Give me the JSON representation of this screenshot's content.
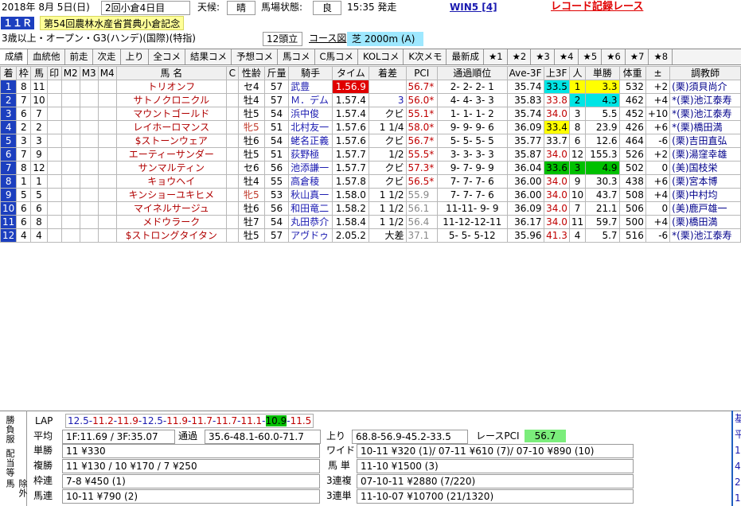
{
  "header": {
    "date": "2018年  8月  5日(日)",
    "meeting": "2回小倉4日目",
    "weather_label": "天候:",
    "weather": "晴",
    "going_label": "馬場状態:",
    "going": "良",
    "start_time": "15:35 発走",
    "win5": "WIN5 [4]",
    "record_race": "レコード記録レース"
  },
  "race": {
    "number": "１１Ｒ",
    "title": "第54回農林水産省賞典小倉記念",
    "conditions": "3歳以上・オープン・G3(ハンデ)(国際)(特指)",
    "runners": "12頭立",
    "course_label": "コース図",
    "course": "芝 2000m (A)"
  },
  "tabs": [
    "成績",
    "血統他",
    "前走",
    "次走",
    "上り",
    "全コメ",
    "結果コメ",
    "予想コメ",
    "馬コメ",
    "C馬コメ",
    "KOLコメ",
    "K次メモ",
    "最新成",
    "★1",
    "★2",
    "★3",
    "★4",
    "★5",
    "★6",
    "★7",
    "★8"
  ],
  "columns": [
    "着",
    "枠",
    "馬",
    "印",
    "M2",
    "M3",
    "M4",
    "馬 名",
    "C",
    "性齢",
    "斤量",
    "騎手",
    "タイム",
    "着差",
    "PCI",
    "通過順位",
    "Ave-3F",
    "上3F",
    "人",
    "単勝",
    "体重",
    "±",
    "調教師"
  ],
  "rows": [
    {
      "rank": "1",
      "waku": "8",
      "uma": "11",
      "name": "トリオンフ",
      "sex": "セ4",
      "kin": "57",
      "jockey": "武豊",
      "time": "1.56.9",
      "margin": "",
      "pci": "56.7*",
      "passing": "2- 2- 2- 1",
      "ave": "35.74",
      "last3f": "33.5",
      "pop": "1",
      "odds": "3.3",
      "weight": "532",
      "diff": "+2",
      "trainer": "(栗)須貝尚介"
    },
    {
      "rank": "2",
      "waku": "7",
      "uma": "10",
      "name": "サトノクロニクル",
      "sex": "牡4",
      "kin": "57",
      "jockey": "Ｍ．デム",
      "time": "1.57.4",
      "margin": "3",
      "pci": "56.0*",
      "passing": "4- 4- 3- 3",
      "ave": "35.83",
      "last3f": "33.8",
      "pop": "2",
      "odds": "4.3",
      "weight": "462",
      "diff": "+4",
      "trainer": "*(栗)池江泰寿"
    },
    {
      "rank": "3",
      "waku": "6",
      "uma": "7",
      "name": "マウントゴールド",
      "sex": "牡5",
      "kin": "54",
      "jockey": "浜中俊",
      "time": "1.57.4",
      "margin": "クビ",
      "pci": "55.1*",
      "passing": "1- 1- 1- 2",
      "ave": "35.74",
      "last3f": "34.0",
      "pop": "3",
      "odds": "5.5",
      "weight": "452",
      "diff": "+10",
      "trainer": "*(栗)池江泰寿"
    },
    {
      "rank": "4",
      "waku": "2",
      "uma": "2",
      "name": "レイホーロマンス",
      "sex": "牝5",
      "kin": "51",
      "jockey": "北村友一",
      "time": "1.57.6",
      "margin": "1 1/4",
      "pci": "58.0*",
      "passing": "9- 9- 9- 6",
      "ave": "36.09",
      "last3f": "33.4",
      "pop": "8",
      "odds": "23.9",
      "weight": "426",
      "diff": "+6",
      "trainer": "*(栗)橋田満"
    },
    {
      "rank": "5",
      "waku": "3",
      "uma": "3",
      "name": "$ストーンウェア",
      "sex": "牡6",
      "kin": "54",
      "jockey": "蛯名正義",
      "time": "1.57.6",
      "margin": "クビ",
      "pci": "56.7*",
      "passing": "5- 5- 5- 5",
      "ave": "35.77",
      "last3f": "33.7",
      "pop": "6",
      "odds": "12.6",
      "weight": "464",
      "diff": "-6",
      "trainer": "(栗)吉田直弘"
    },
    {
      "rank": "6",
      "waku": "7",
      "uma": "9",
      "name": "エーティーサンダー",
      "sex": "牡5",
      "kin": "51",
      "jockey": "荻野極",
      "time": "1.57.7",
      "margin": "1/2",
      "pci": "55.5*",
      "passing": "3- 3- 3- 3",
      "ave": "35.87",
      "last3f": "34.0",
      "pop": "12",
      "odds": "155.3",
      "weight": "526",
      "diff": "+2",
      "trainer": "(栗)湯窪幸雄"
    },
    {
      "rank": "7",
      "waku": "8",
      "uma": "12",
      "name": "サンマルティン",
      "sex": "セ6",
      "kin": "56",
      "jockey": "池添謙一",
      "time": "1.57.7",
      "margin": "クビ",
      "pci": "57.3*",
      "passing": "9- 7- 9- 9",
      "ave": "36.04",
      "last3f": "33.6",
      "pop": "3",
      "odds": "4.9",
      "weight": "502",
      "diff": "0",
      "trainer": "(美)国枝栄"
    },
    {
      "rank": "8",
      "waku": "1",
      "uma": "1",
      "name": "キョウヘイ",
      "sex": "牡4",
      "kin": "55",
      "jockey": "高倉稜",
      "time": "1.57.8",
      "margin": "クビ",
      "pci": "56.5*",
      "passing": "7- 7- 7- 6",
      "ave": "36.00",
      "last3f": "34.0",
      "pop": "9",
      "odds": "30.3",
      "weight": "438",
      "diff": "+6",
      "trainer": "(栗)宮本博"
    },
    {
      "rank": "9",
      "waku": "5",
      "uma": "5",
      "name": "キンショーユキヒメ",
      "sex": "牝5",
      "kin": "53",
      "jockey": "秋山真一",
      "time": "1.58.0",
      "margin": "1 1/2",
      "pci": "55.9",
      "passing": "7- 7- 7- 6",
      "ave": "36.00",
      "last3f": "34.0",
      "pop": "10",
      "odds": "43.7",
      "weight": "508",
      "diff": "+4",
      "trainer": "(栗)中村均"
    },
    {
      "rank": "10",
      "waku": "6",
      "uma": "6",
      "name": "マイネルサージュ",
      "sex": "牡6",
      "kin": "56",
      "jockey": "和田竜二",
      "time": "1.58.2",
      "margin": "1 1/2",
      "pci": "56.1",
      "passing": "11-11- 9- 9",
      "ave": "36.09",
      "last3f": "34.0",
      "pop": "7",
      "odds": "21.1",
      "weight": "506",
      "diff": "0",
      "trainer": "(美)鹿戸雄一"
    },
    {
      "rank": "11",
      "waku": "6",
      "uma": "8",
      "name": "メドウラーク",
      "sex": "牡7",
      "kin": "54",
      "jockey": "丸田恭介",
      "time": "1.58.4",
      "margin": "1 1/2",
      "pci": "56.4",
      "passing": "11-12-12-11",
      "ave": "36.17",
      "last3f": "34.0",
      "pop": "11",
      "odds": "59.7",
      "weight": "500",
      "diff": "+4",
      "trainer": "(栗)橋田満"
    },
    {
      "rank": "12",
      "waku": "4",
      "uma": "4",
      "name": "$ストロングタイタン",
      "sex": "牡5",
      "kin": "57",
      "jockey": "アヴドゥ",
      "time": "2.05.2",
      "margin": "大差",
      "pci": "37.1",
      "passing": "5- 5- 5-12",
      "ave": "35.96",
      "last3f": "41.3",
      "pop": "4",
      "odds": "5.7",
      "weight": "516",
      "diff": "-6",
      "trainer": "*(栗)池江泰寿"
    }
  ],
  "colors": {
    "number_bg": "#1c3fbf",
    "best_time": "#e00000",
    "last3f_best": "#00c000",
    "last3f_second": "#ffff00",
    "pop_cyan": "#00e5e5",
    "pop_yellow": "#ffff00"
  },
  "bottom": {
    "vtab1": "勝負服",
    "vtab2": "配当等",
    "vtab3": "除外馬",
    "lap_label": "LAP",
    "laps": [
      "12.5",
      "11.2",
      "11.9",
      "12.5",
      "11.9",
      "11.7",
      "11.7",
      "11.1",
      "10.9",
      "11.5"
    ],
    "avg_label": "平均",
    "avg": "1F:11.69 / 3F:35.07",
    "passing_label": "通過",
    "passing": "35.6-48.1-60.0-71.7",
    "agari_label": "上り",
    "agari": "68.8-56.9-45.2-33.5",
    "race_pci_label": "レースPCI",
    "race_pci": "56.7",
    "tansho_label": "単勝",
    "tansho": "11 ¥330",
    "fukusho_label": "複勝",
    "fukusho": "11 ¥130 / 10 ¥170 / 7 ¥250",
    "wakuren_label": "枠連",
    "wakuren": "7-8 ¥450 (1)",
    "umaren_label": "馬連",
    "umaren": "10-11 ¥790 (2)",
    "wide_label": "ワイド",
    "wide": "10-11 ¥320 (1)/ 07-11 ¥610 (7)/ 07-10 ¥890 (10)",
    "umatan_label": "馬 単",
    "umatan": "11-10 ¥1500 (3)",
    "sanrenpuku_label": "3連複",
    "sanrenpuku": "07-10-11 ¥2880 (7/220)",
    "sanrentan_label": "3連単",
    "sanrentan": "11-10-07 ¥10700 (21/1320)"
  },
  "right_panel": [
    "基",
    "平",
    "1-",
    "4",
    "2:",
    "1:"
  ]
}
